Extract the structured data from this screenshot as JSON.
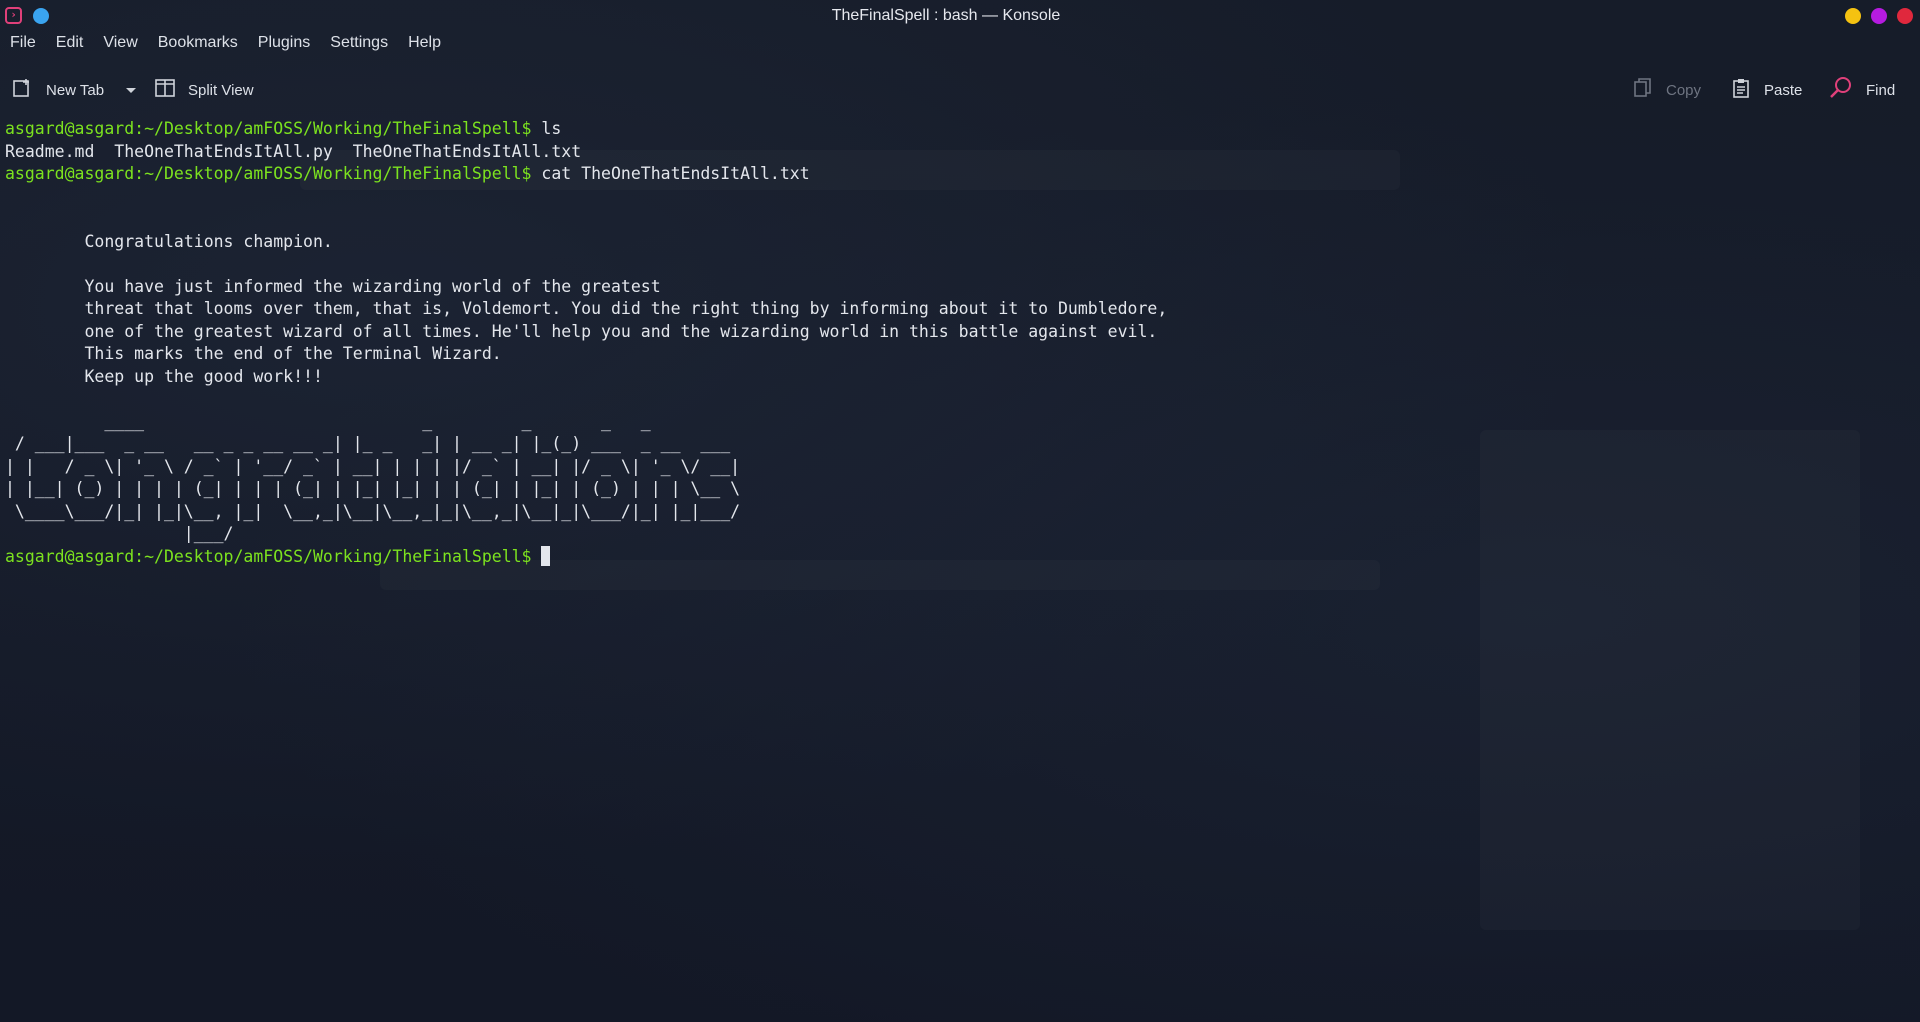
{
  "window": {
    "title": "TheFinalSpell : bash — Konsole",
    "button_colors": {
      "minimize": "#f5c211",
      "maximize": "#b61be0",
      "close": "#e0283d"
    }
  },
  "menubar": {
    "items": [
      "File",
      "Edit",
      "View",
      "Bookmarks",
      "Plugins",
      "Settings",
      "Help"
    ]
  },
  "toolbar": {
    "new_tab_label": "New Tab",
    "split_view_label": "Split View",
    "copy_label": "Copy",
    "paste_label": "Paste",
    "find_label": "Find"
  },
  "terminal": {
    "prompt": "asgard@asgard:~/Desktop/amFOSS/Working/TheFinalSpell$",
    "cmd1": " ls",
    "ls_output": "Readme.md  TheOneThatEndsItAll.py  TheOneThatEndsItAll.txt",
    "cmd2": " cat TheOneThatEndsItAll.txt",
    "message": "\n\n\tCongratulations champion.\n\n\tYou have just informed the wizarding world of the greatest\n\tthreat that looms over them, that is, Voldemort. You did the right thing by informing about it to Dumbledore,\n\tone of the greatest wizard of all times. He'll help you and the wizarding world in this battle against evil.\n\tThis marks the end of the Terminal Wizard.\n\tKeep up the good work!!!\n",
    "ascii_art": "          ____                            _         _       _   _\n / ___|___  _ __   __ _ _ __ __ _| |_ _   _| | __ _| |_(_) ___  _ __  ___\n| |   / _ \\| '_ \\ / _` | '__/ _` | __| | | | |/ _` | __| |/ _ \\| '_ \\/ __|\n| |__| (_) | | | | (_| | | | (_| | |_| |_| | | (_| | |_| | (_) | | | \\__ \\\n \\____\\___/|_| |_|\\__, |_|  \\__,_|\\__|\\__,_|_|\\__,_|\\__|_|\\___/|_| |_|___/\n                  |___/"
  },
  "colors": {
    "prompt": "#7ce21f",
    "background": "#141a27",
    "text": "#e3e6ec"
  }
}
